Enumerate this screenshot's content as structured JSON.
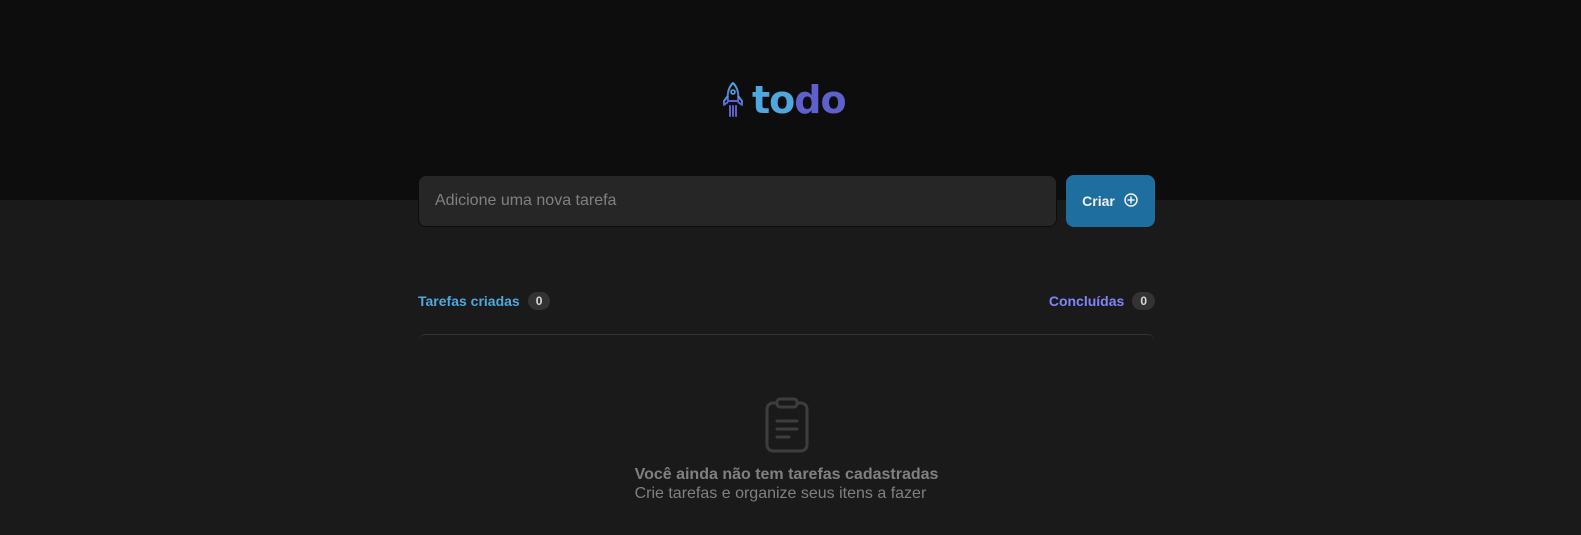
{
  "app": {
    "logo_text_part1": "to",
    "logo_text_part2": "do",
    "logo_icon": "rocket-icon"
  },
  "form": {
    "placeholder": "Adicione uma nova tarefa",
    "value": "",
    "create_label": "Criar",
    "create_icon": "plus-circle-icon"
  },
  "counters": {
    "created_label": "Tarefas criadas",
    "created_count": "0",
    "done_label": "Concluídas",
    "done_count": "0"
  },
  "empty_state": {
    "icon": "clipboard-icon",
    "title": "Você ainda não tem tarefas cadastradas",
    "subtitle": "Crie tarefas e organize seus itens a fazer"
  },
  "colors": {
    "header_bg": "#0d0d0d",
    "page_bg": "#1a1a1a",
    "blue": "#4ea8de",
    "blue_dark": "#1e6f9f",
    "purple": "#5e60ce",
    "purple_light": "#8284fa"
  }
}
